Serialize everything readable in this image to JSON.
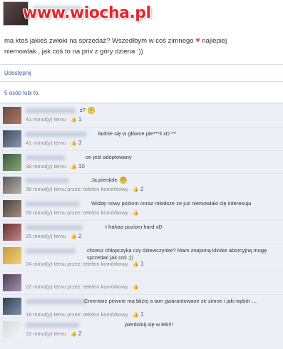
{
  "watermark": "www.wiocha.pl",
  "post": {
    "line1": "ma ktoś jakieś zwłoki na sprzedaż? Wszedłbym w coś zimnego",
    "heart": "♥",
    "line1_end": "najlepiej",
    "line2": "niemowlak , jak coś to na priv z góry dziena :))"
  },
  "actions": {
    "share_label": "Udostępnij"
  },
  "likes_text": "5 osób lubi to.",
  "colors": {
    "link": "#3b5998",
    "watermark": "#e3262c",
    "comment_bg": "#eceff5"
  },
  "comments": [
    {
      "text": "z?",
      "emoji": "☺",
      "meta_time": "41 minut(y) temu",
      "meta_via": "",
      "like_count": "1"
    },
    {
      "text": "ładnie się w główce pie***li xD ^^",
      "emoji": "",
      "meta_time": "41 minut(y) temu",
      "meta_via": "",
      "like_count": "3"
    },
    {
      "text": "on jest adoptowany",
      "emoji": "",
      "meta_time": "39 minut(y) temu",
      "meta_via": "",
      "like_count": "10"
    },
    {
      "text": "Ja pierdole",
      "emoji": "☹",
      "meta_time": "38 minut(y) temu",
      "meta_via": "przez: telefon komórkowy",
      "like_count": "2"
    },
    {
      "text": "Widzę nowy poziom coraz młodsze ze już niemowlaki cię interesuja",
      "emoji": "",
      "meta_time": "26 minut(y) temu",
      "meta_via": "przez: telefon komórkowy",
      "like_count": ""
    },
    {
      "text": "t hahaa poziom hard xD",
      "emoji": "",
      "meta_time": "25 minut(y) temu",
      "meta_via": "",
      "like_count": "2"
    },
    {
      "text": "chcesz chłopczyka czy dziewczynke? Mam znajomą klinike aborcyjną mogę sprzedać jak coś ;))",
      "emoji": "",
      "meta_time": "24 minut(y) temu",
      "meta_via": "przez: telefon komórkowy",
      "like_count": "1"
    },
    {
      "text": "",
      "emoji": "",
      "meta_time": "22 minut(y) temu",
      "meta_via": "przez: telefon komórkowy",
      "like_count": ""
    },
    {
      "text": "Cmentarz pewnie ma bliżej a tam gwarantowane ze zimne i jaki wybór ....",
      "emoji": "",
      "meta_time": "19 minut(y) temu",
      "meta_via": "przez: telefon komórkowy",
      "like_count": "1"
    },
    {
      "text": "pierdolnij się w łeb!!!",
      "emoji": "",
      "meta_time": "12 minut(y) temu",
      "meta_via": "",
      "like_count": "2"
    }
  ],
  "labels": {
    "like_icon": "thumbs-up-icon",
    "dot": "·"
  }
}
